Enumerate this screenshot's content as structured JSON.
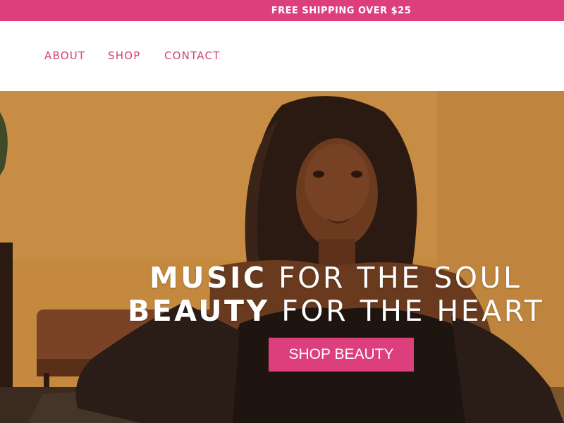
{
  "announcement": {
    "text": "FREE SHIPPING OVER $25"
  },
  "nav": {
    "about": "ABOUT",
    "shop": "SHOP",
    "contact": "CONTACT"
  },
  "hero": {
    "line1_bold": "MUSIC",
    "line1_rest": " FOR THE SOUL",
    "line2_bold": "BEAUTY",
    "line2_rest": " FOR THE HEART",
    "cta_label": "SHOP BEAUTY"
  },
  "colors": {
    "brand_pink": "#dc3f7b",
    "nav_pink": "#d43f77",
    "hero_tone": "#c08436"
  }
}
